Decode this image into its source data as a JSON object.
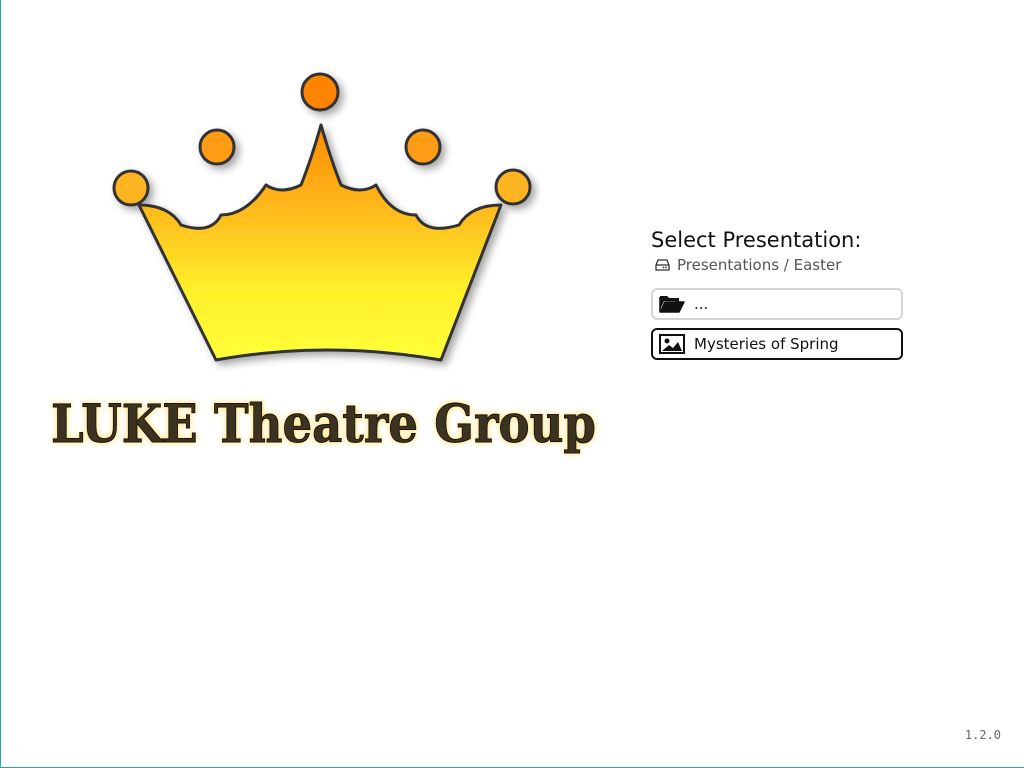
{
  "logo": {
    "title": "LUKE Theatre Group",
    "icon": "crown-icon",
    "colors": {
      "crown_top": "#ff8c00",
      "crown_bottom": "#ffff33",
      "text_fill": "#3a3020",
      "text_glow": "#ffd84a"
    }
  },
  "panel": {
    "title": "Select Presentation:",
    "breadcrumb": {
      "icon": "drive-icon",
      "path": "Presentations / Easter"
    },
    "entries": [
      {
        "icon": "folder-open-icon",
        "label": "...",
        "type": "folder"
      },
      {
        "icon": "image-icon",
        "label": "Mysteries of Spring",
        "type": "presentation"
      }
    ]
  },
  "version": "1.2.0"
}
